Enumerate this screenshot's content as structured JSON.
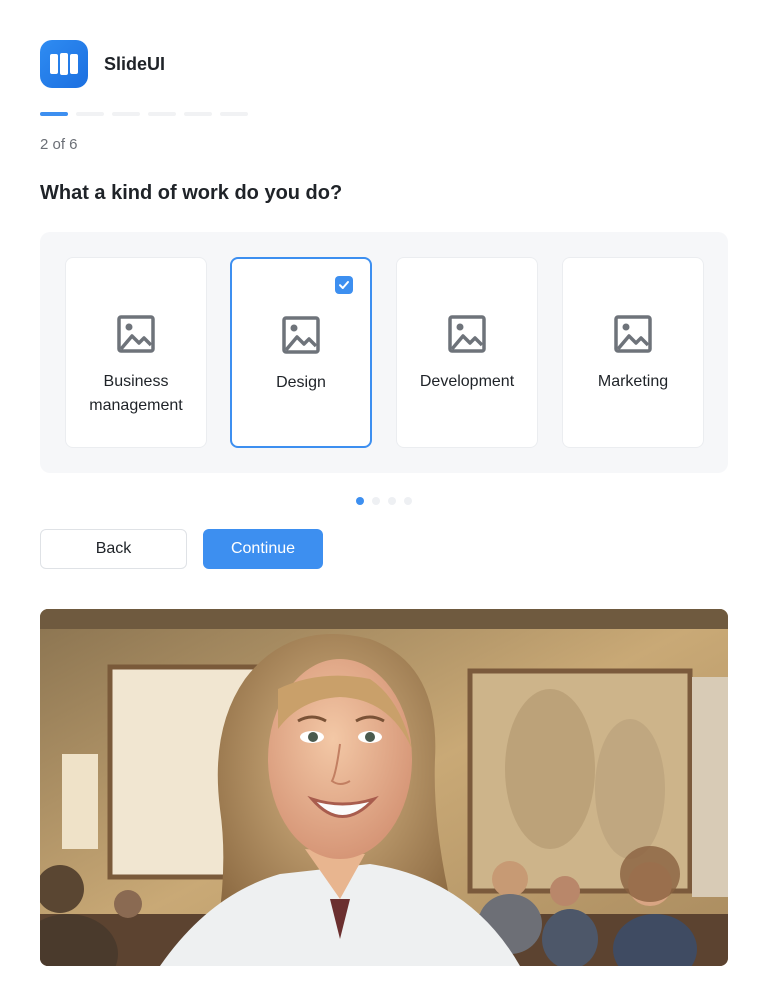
{
  "app": {
    "name": "SlideUI",
    "logo_icon": "slideui-logo-icon"
  },
  "progress": {
    "current": 2,
    "total": 6,
    "label": "2 of 6"
  },
  "question": "What a kind of work do you do?",
  "options": [
    {
      "label": "Business\nmanagement",
      "icon": "image-placeholder-icon",
      "selected": false
    },
    {
      "label": "Design",
      "icon": "image-placeholder-icon",
      "selected": true
    },
    {
      "label": "Development",
      "icon": "image-placeholder-icon",
      "selected": false
    },
    {
      "label": "Marketing",
      "icon": "image-placeholder-icon",
      "selected": false
    }
  ],
  "carousel": {
    "pages": 4,
    "current": 1
  },
  "buttons": {
    "back": "Back",
    "continue": "Continue"
  },
  "colors": {
    "accent": "#3d8ff0",
    "panel": "#f6f7f9",
    "text": "#1f2328",
    "muted": "#6b6f76"
  }
}
